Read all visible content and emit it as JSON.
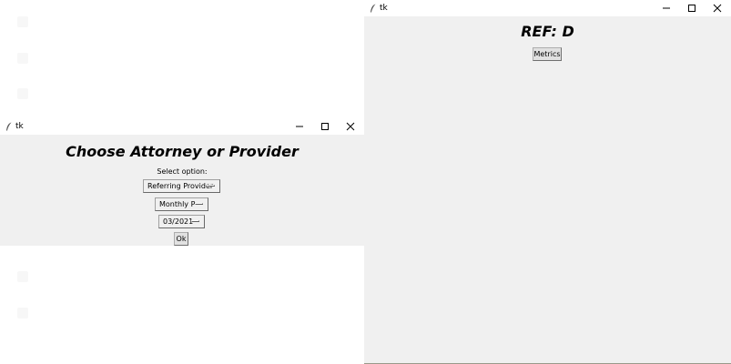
{
  "select_window": {
    "title": "tk",
    "heading": "Choose Attorney or Provider",
    "prompt_label": "Select option:",
    "option_type": "Referring Provider",
    "option_period": "Monthly P",
    "option_date": "03/2021",
    "ok_label": "Ok"
  },
  "ref_window": {
    "title": "tk",
    "heading": "REF: D",
    "metrics_label": "Metrics"
  },
  "icons": [
    "feather-icon",
    "minimize-icon",
    "maximize-icon",
    "close-icon",
    "dropdown-indicator-icon"
  ]
}
